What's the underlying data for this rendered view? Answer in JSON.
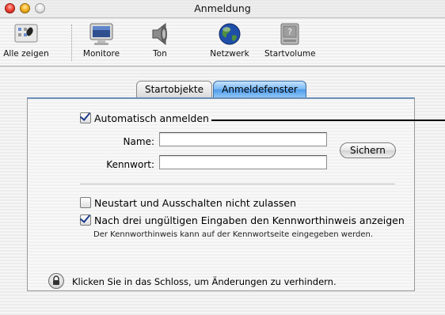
{
  "window": {
    "title": "Anmeldung"
  },
  "toolbar": {
    "items": [
      {
        "label": "Alle zeigen",
        "icon": "show-all-icon"
      },
      {
        "label": "Monitore",
        "icon": "monitor-icon"
      },
      {
        "label": "Ton",
        "icon": "speaker-icon"
      },
      {
        "label": "Netzwerk",
        "icon": "globe-icon"
      },
      {
        "label": "Startvolume",
        "icon": "disk-icon"
      }
    ]
  },
  "tabs": [
    {
      "label": "Startobjekte",
      "selected": false
    },
    {
      "label": "Anmeldefenster",
      "selected": true
    }
  ],
  "login": {
    "auto_login_label": "Automatisch anmelden",
    "auto_login_checked": true,
    "name_label": "Name:",
    "name_value": "",
    "password_label": "Kennwort:",
    "password_value": "",
    "save_button": "Sichern"
  },
  "options": {
    "restart_label": "Neustart und Ausschalten nicht zulassen",
    "restart_checked": false,
    "hint_label": "Nach drei ungültigen Eingaben den Kennworthinweis anzeigen",
    "hint_checked": true,
    "hint_note": "Der Kennworthinweis kann auf der Kennwortseite eingegeben werden."
  },
  "lock": {
    "text": "Klicken Sie in das Schloss, um Änderungen zu verhindern."
  },
  "colors": {
    "selected_tab": "#6aaef0",
    "close_button": "#f0463a",
    "minimize_button": "#f5b52a"
  }
}
